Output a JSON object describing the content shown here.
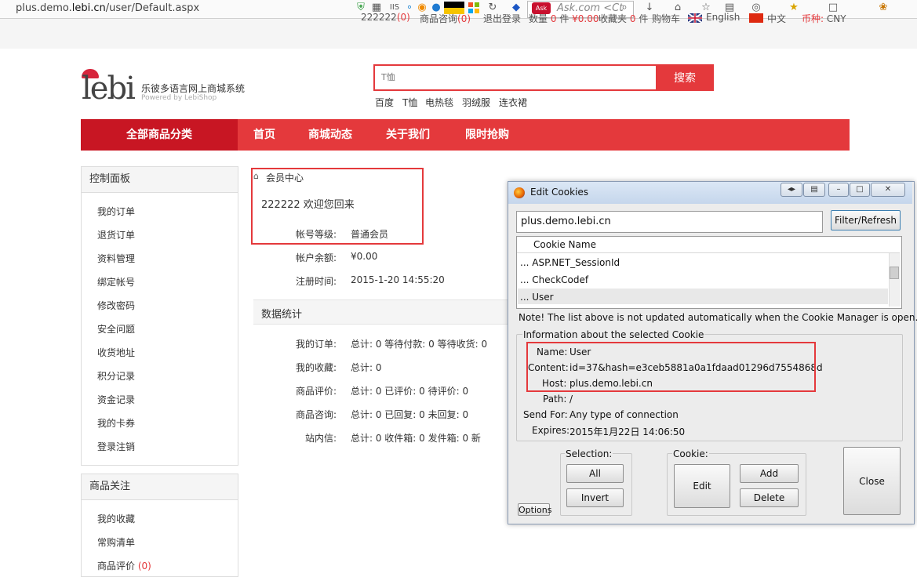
{
  "browser": {
    "url_prefix": "plus.demo.",
    "url_domain": "lebi.cn",
    "url_suffix": "/user/Default.aspx",
    "ask_placeholder": "Ask.com <Ct"
  },
  "top_links": {
    "user": "222222",
    "user_count": "(0)",
    "consult": "商品咨询",
    "consult_count": "(0)",
    "logout": "退出登录",
    "qty_label": "数量",
    "qty_value": "0",
    "piece": "件",
    "amount": "¥0.00",
    "favorites": "收藏夹",
    "fav_value": "0",
    "fav_unit": "件",
    "cart": "购物车",
    "english": "English",
    "chinese": "中文",
    "currency_label": "币种:",
    "currency_value": "CNY"
  },
  "header": {
    "logo": "lebi",
    "title": "乐彼多语言网上商城系统",
    "subtitle": "Powered by LebiShop",
    "search_placeholder": "T恤",
    "search_button": "搜索",
    "hot_keywords": [
      "百度",
      "T恤",
      "电热毯",
      "羽绒服",
      "连衣裙"
    ]
  },
  "nav": {
    "all": "全部商品分类",
    "items": [
      "首页",
      "商城动态",
      "关于我们",
      "限时抢购"
    ]
  },
  "sidebar": {
    "panel_title": "控制面板",
    "items": [
      "我的订单",
      "退货订单",
      "资料管理",
      "绑定帐号",
      "修改密码",
      "安全问题",
      "收货地址",
      "积分记录",
      "资金记录",
      "我的卡券",
      "登录注销"
    ],
    "panel2_title": "商品关注",
    "items2": [
      "我的收藏",
      "常购清单",
      "商品评价"
    ],
    "items2_count": "(0)"
  },
  "main": {
    "breadcrumb": "会员中心",
    "welcome": "222222 欢迎您回来",
    "level_label": "帐号等级:",
    "level_value": "普通会员",
    "balance_label": "帐户余额:",
    "balance_value": "¥0.00",
    "reg_label": "注册时间:",
    "reg_value": "2015-1-20 14:55:20",
    "stats_title": "数据统计",
    "stats": [
      {
        "label": "我的订单:",
        "text": "总计: 0   等待付款: 0   等待收货: 0"
      },
      {
        "label": "我的收藏:",
        "text": "总计: 0"
      },
      {
        "label": "商品评价:",
        "text": "总计: 0   已评价: 0   待评价: 0"
      },
      {
        "label": "商品咨询:",
        "text": "总计: 0   已回复: 0   未回复: 0"
      },
      {
        "label": "站内信:",
        "text": "总计: 0   收件箱: 0   发件箱: 0   新"
      }
    ]
  },
  "dialog": {
    "title": "Edit Cookies",
    "filter_value": "plus.demo.lebi.cn",
    "filter_button": "Filter/Refresh",
    "column_header": "Cookie Name",
    "cookies": [
      "ASP.NET_SessionId",
      "CheckCodef",
      "User"
    ],
    "note": "Note! The list above is not updated automatically when the Cookie Manager is open.",
    "info_title": "Information about the selected Cookie",
    "fields": [
      {
        "label": "Name:",
        "value": "User"
      },
      {
        "label": "Content:",
        "value": "id=37&hash=e3ceb5881a0a1fdaad01296d7554868d"
      },
      {
        "label": "Host:",
        "value": "plus.demo.lebi.cn"
      },
      {
        "label": "Path:",
        "value": "/"
      },
      {
        "label": "Send For:",
        "value": "Any type of connection"
      },
      {
        "label": "Expires:",
        "value": "2015年1月22日 14:06:50"
      }
    ],
    "selection_label": "Selection:",
    "all_button": "All",
    "invert_button": "Invert",
    "cookie_label": "Cookie:",
    "edit_button": "Edit",
    "add_button": "Add",
    "delete_button": "Delete",
    "close_button": "Close",
    "options_button": "Options"
  },
  "colors": {
    "accent": "#e4393c",
    "accent_dark": "#c81623"
  }
}
